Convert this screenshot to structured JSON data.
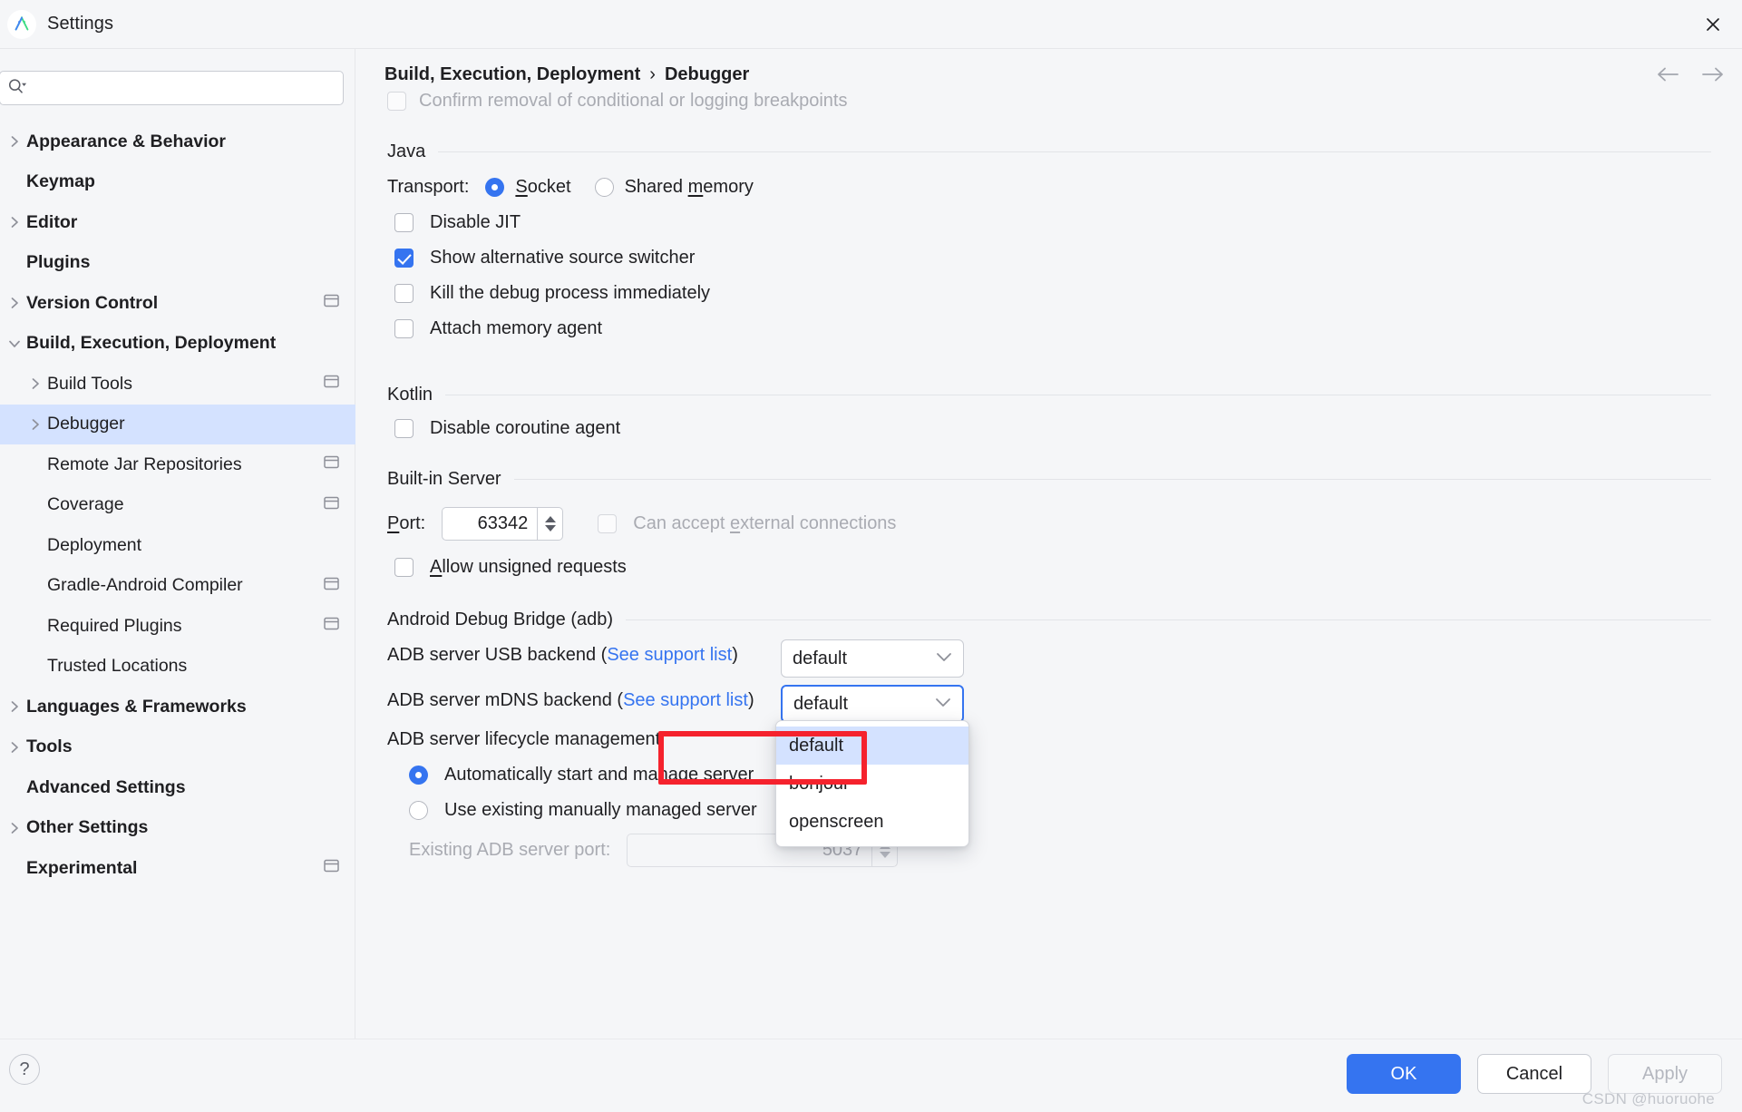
{
  "window": {
    "title": "Settings",
    "app_icon": "android-studio-icon",
    "close_icon": "close-icon"
  },
  "sidebar": {
    "search": {
      "placeholder": "",
      "value": "",
      "icon": "search-icon"
    },
    "items": [
      {
        "label": "Appearance & Behavior",
        "level": 0,
        "chevron": "right",
        "selected": false,
        "scope_icon": false
      },
      {
        "label": "Keymap",
        "level": 0,
        "chevron": "none",
        "selected": false,
        "scope_icon": false
      },
      {
        "label": "Editor",
        "level": 0,
        "chevron": "right",
        "selected": false,
        "scope_icon": false
      },
      {
        "label": "Plugins",
        "level": 0,
        "chevron": "none",
        "selected": false,
        "scope_icon": false
      },
      {
        "label": "Version Control",
        "level": 0,
        "chevron": "right",
        "selected": false,
        "scope_icon": true
      },
      {
        "label": "Build, Execution, Deployment",
        "level": 0,
        "chevron": "down",
        "selected": false,
        "scope_icon": false
      },
      {
        "label": "Build Tools",
        "level": 1,
        "chevron": "right",
        "selected": false,
        "scope_icon": true
      },
      {
        "label": "Debugger",
        "level": 1,
        "chevron": "right",
        "selected": true,
        "scope_icon": false
      },
      {
        "label": "Remote Jar Repositories",
        "level": 1,
        "chevron": "none",
        "selected": false,
        "scope_icon": true
      },
      {
        "label": "Coverage",
        "level": 1,
        "chevron": "none",
        "selected": false,
        "scope_icon": true
      },
      {
        "label": "Deployment",
        "level": 1,
        "chevron": "none",
        "selected": false,
        "scope_icon": false
      },
      {
        "label": "Gradle-Android Compiler",
        "level": 1,
        "chevron": "none",
        "selected": false,
        "scope_icon": true
      },
      {
        "label": "Required Plugins",
        "level": 1,
        "chevron": "none",
        "selected": false,
        "scope_icon": true
      },
      {
        "label": "Trusted Locations",
        "level": 1,
        "chevron": "none",
        "selected": false,
        "scope_icon": false
      },
      {
        "label": "Languages & Frameworks",
        "level": 0,
        "chevron": "right",
        "selected": false,
        "scope_icon": false
      },
      {
        "label": "Tools",
        "level": 0,
        "chevron": "right",
        "selected": false,
        "scope_icon": false
      },
      {
        "label": "Advanced Settings",
        "level": 0,
        "chevron": "none",
        "selected": false,
        "scope_icon": false
      },
      {
        "label": "Other Settings",
        "level": 0,
        "chevron": "right",
        "selected": false,
        "scope_icon": false
      },
      {
        "label": "Experimental",
        "level": 0,
        "chevron": "none",
        "selected": false,
        "scope_icon": true
      }
    ]
  },
  "breadcrumb": {
    "parent": "Build, Execution, Deployment",
    "separator": "›",
    "current": "Debugger",
    "back_icon": "arrow-left-icon",
    "forward_icon": "arrow-right-icon"
  },
  "content": {
    "clipped_checkbox_label": "Confirm removal of conditional or logging breakpoints",
    "java": {
      "section_title": "Java",
      "transport_label": "Transport:",
      "transport_options": [
        {
          "label": "Socket",
          "selected": true
        },
        {
          "label": "Shared memory",
          "selected": false
        }
      ],
      "checkboxes": [
        {
          "label": "Disable JIT",
          "checked": false
        },
        {
          "label": "Show alternative source switcher",
          "checked": true
        },
        {
          "label": "Kill the debug process immediately",
          "checked": false
        },
        {
          "label": "Attach memory agent",
          "checked": false
        }
      ]
    },
    "kotlin": {
      "section_title": "Kotlin",
      "checkboxes": [
        {
          "label": "Disable coroutine agent",
          "checked": false
        }
      ]
    },
    "builtin_server": {
      "section_title": "Built-in Server",
      "port_label": "Port:",
      "port_value": "63342",
      "external_connections_label": "Can accept external connections",
      "external_connections_checked": false,
      "allow_unsigned_label": "Allow unsigned requests",
      "allow_unsigned_checked": false
    },
    "adb": {
      "section_title": "Android Debug Bridge (adb)",
      "usb_backend_label": "ADB server USB backend (",
      "usb_backend_link": "See support list",
      "usb_backend_label_end": ")",
      "usb_backend_value": "default",
      "mdns_backend_label": "ADB server mDNS backend (",
      "mdns_backend_link": "See support list",
      "mdns_backend_label_end": ")",
      "mdns_backend_value": "default",
      "mdns_options": [
        {
          "label": "default",
          "highlighted": true
        },
        {
          "label": "bonjour",
          "highlighted": false
        },
        {
          "label": "openscreen",
          "highlighted": false
        }
      ],
      "lifecycle_label": "ADB server lifecycle management",
      "lifecycle_options": [
        {
          "label": "Automatically start and manage server",
          "selected": true
        },
        {
          "label": "Use existing manually managed server",
          "selected": false
        }
      ],
      "existing_port_label": "Existing ADB server port:",
      "existing_port_value": "5037"
    }
  },
  "footer": {
    "help_label": "?",
    "ok_label": "OK",
    "cancel_label": "Cancel",
    "apply_label": "Apply",
    "watermark": "CSDN @huoruohe"
  },
  "colors": {
    "accent": "#3574f0",
    "selection": "#d4e2ff",
    "link": "#3574f0",
    "highlight_box": "#f5222d",
    "background": "#f5f6f8"
  }
}
